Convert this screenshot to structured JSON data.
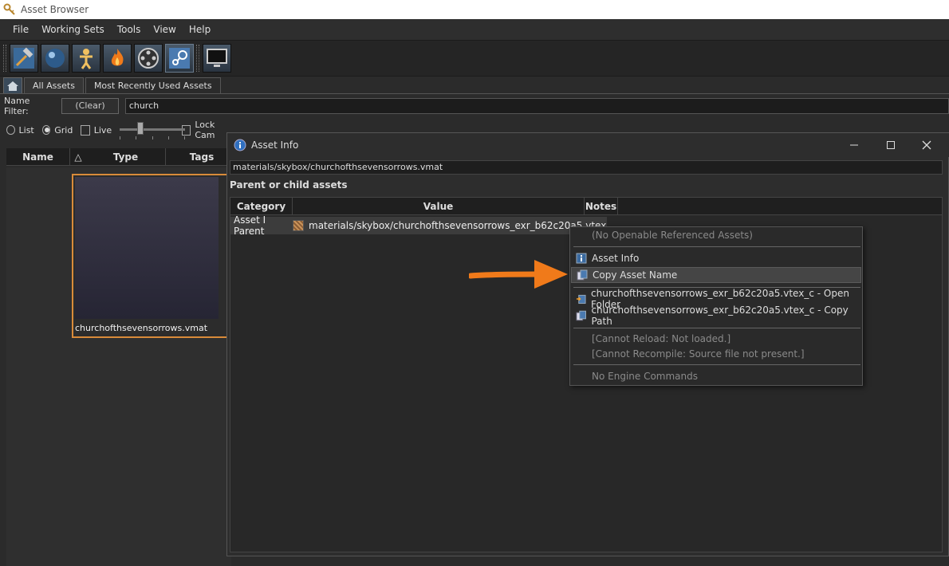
{
  "window": {
    "title": "Asset Browser",
    "app_icon": "key-icon"
  },
  "menu": [
    "File",
    "Working Sets",
    "Tools",
    "View",
    "Help"
  ],
  "toolbar": {
    "buttons": [
      {
        "name": "hammer-icon"
      },
      {
        "name": "sphere-icon"
      },
      {
        "name": "person-icon"
      },
      {
        "name": "fire-icon"
      },
      {
        "name": "film-reel-icon"
      },
      {
        "name": "steam-icon"
      },
      {
        "name": "monitor-icon"
      }
    ]
  },
  "tabs": {
    "home_icon": "home-icon",
    "items": [
      "All Assets",
      "Most Recently Used Assets"
    ]
  },
  "filter": {
    "label": "Name Filter:",
    "clear": "(Clear)",
    "value": "church"
  },
  "view": {
    "list": "List",
    "grid": "Grid",
    "live": "Live",
    "lock_cam": "Lock Cam",
    "selected": "Grid"
  },
  "columns": [
    "Name",
    "Type",
    "Tags"
  ],
  "grid": {
    "items": [
      {
        "label": "churchofthsevensorrows.vmat",
        "selected": true
      }
    ]
  },
  "dialog": {
    "title": "Asset Info",
    "path": "materials/skybox/churchofthsevensorrows.vmat",
    "section": "Parent or child assets",
    "columns": [
      "Category",
      "Value",
      "Notes"
    ],
    "rows": [
      {
        "category": "Asset I Parent",
        "value": "materials/skybox/churchofthsevensorrows_exr_b62c20a5.vtex"
      }
    ]
  },
  "context_menu": {
    "items": [
      {
        "label": "(No Openable Referenced Assets)",
        "disabled": true
      },
      {
        "label": "Asset Info",
        "icon": "info-icon"
      },
      {
        "label": "Copy Asset Name",
        "icon": "copy-icon",
        "highlighted": true
      },
      {
        "label": "churchofthsevensorrows_exr_b62c20a5.vtex_c - Open Folder",
        "icon": "folder-icon"
      },
      {
        "label": "churchofthsevensorrows_exr_b62c20a5.vtex_c - Copy Path",
        "icon": "copy-icon"
      },
      {
        "label": "[Cannot Reload: Not loaded.]",
        "disabled": true
      },
      {
        "label": "[Cannot Recompile: Source file not present.]",
        "disabled": true
      },
      {
        "label": "No Engine Commands",
        "disabled": true
      }
    ]
  },
  "colors": {
    "accent_orange": "#f07a1a",
    "selection_border": "#d98b3a",
    "background": "#2b2b2b"
  }
}
